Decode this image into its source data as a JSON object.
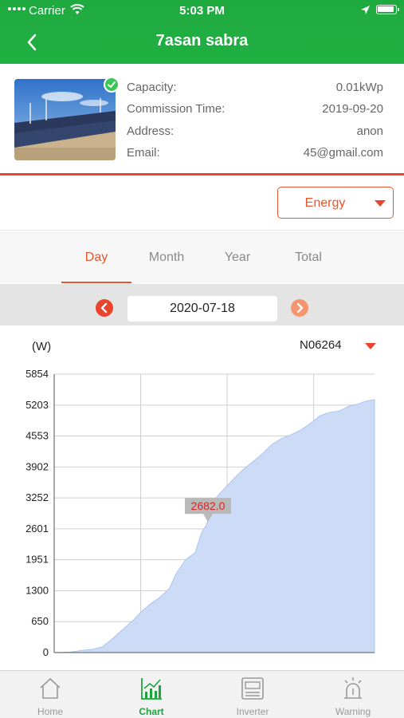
{
  "status_bar": {
    "carrier": "Carrier",
    "time": "5:03 PM"
  },
  "header": {
    "title": "7asan sabra"
  },
  "plant": {
    "verified": true,
    "rows": [
      {
        "label": "Capacity:",
        "value": "0.01kWp"
      },
      {
        "label": "Commission Time:",
        "value": "2019-09-20"
      },
      {
        "label": "Address:",
        "value": "anon"
      },
      {
        "label": "Email:",
        "value": "45@gmail.com"
      }
    ]
  },
  "type_select": {
    "value": "Energy"
  },
  "tabs": [
    {
      "label": "Day",
      "active": true
    },
    {
      "label": "Month",
      "active": false
    },
    {
      "label": "Year",
      "active": false
    },
    {
      "label": "Total",
      "active": false
    }
  ],
  "date_picker": {
    "date": "2020-07-18"
  },
  "chart_header": {
    "unit": "(W)",
    "device": "N06264"
  },
  "chart_data": {
    "type": "area",
    "ylabel": "(W)",
    "yticks": [
      "5854",
      "5203",
      "4553",
      "3902",
      "3252",
      "2601",
      "1951",
      "1300",
      "650",
      "0"
    ],
    "ylim": [
      0,
      5854
    ],
    "xlim": [
      0,
      100
    ],
    "grid": true,
    "tooltip": {
      "x": 48,
      "value": "2682.0"
    },
    "series": [
      {
        "color": "#cddcf6",
        "x": [
          0,
          5,
          8,
          12,
          15,
          18,
          22,
          25,
          27,
          30,
          33,
          36,
          38,
          41,
          44,
          46,
          47.5,
          49,
          50.5,
          53,
          56,
          59,
          62,
          65,
          68,
          71,
          74,
          77,
          80,
          83,
          86,
          89,
          92,
          95,
          97,
          100
        ],
        "y": [
          0,
          10,
          40,
          70,
          120,
          280,
          520,
          700,
          850,
          1020,
          1160,
          1350,
          1650,
          1950,
          2100,
          2520,
          2682,
          2960,
          3250,
          3440,
          3650,
          3850,
          4010,
          4180,
          4380,
          4500,
          4580,
          4680,
          4820,
          4980,
          5050,
          5080,
          5180,
          5230,
          5280,
          5320
        ]
      }
    ]
  },
  "bottom_nav": [
    {
      "label": "Home",
      "icon": "home-icon",
      "active": false
    },
    {
      "label": "Chart",
      "icon": "chart-icon",
      "active": true
    },
    {
      "label": "Inverter",
      "icon": "inverter-icon",
      "active": false
    },
    {
      "label": "Warning",
      "icon": "warning-icon",
      "active": false
    }
  ],
  "colors": {
    "brand_green": "#21b043",
    "accent_orange": "#e8552c",
    "area_fill": "#cddcf6"
  }
}
